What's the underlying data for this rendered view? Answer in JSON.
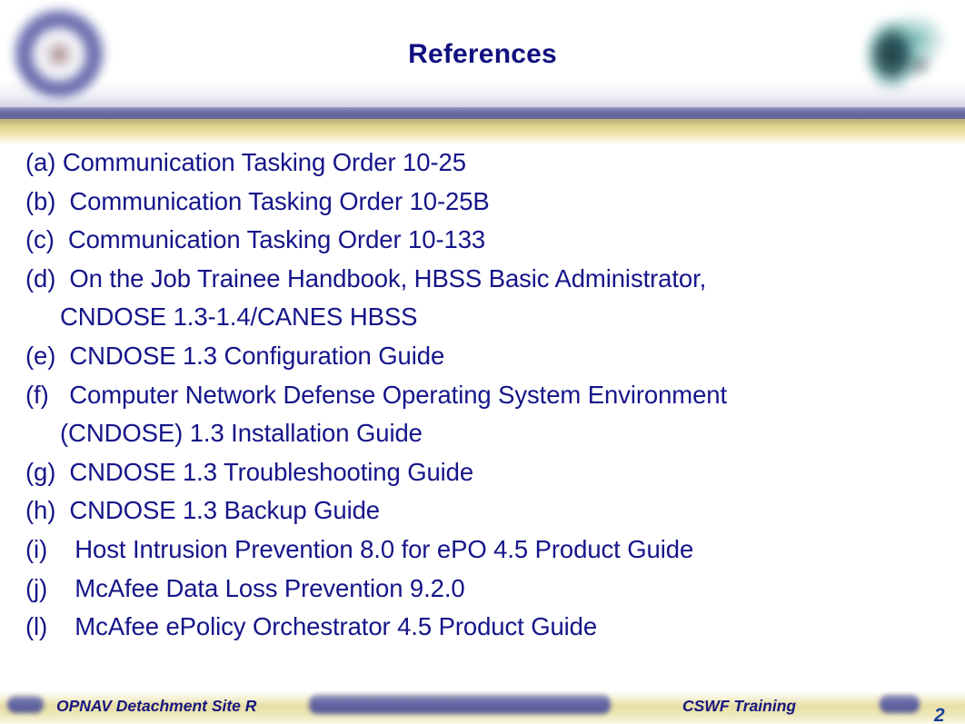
{
  "slide": {
    "title": "References",
    "title_color": "#101080",
    "body_text_color": "#15158a",
    "accent_purple": "#63669e",
    "accent_gold": "#e7dda0",
    "background": "#ffffff"
  },
  "header": {
    "title": "References",
    "logo_left_name": "navy-seal-emblem",
    "logo_right_name": "teal-command-emblem"
  },
  "references": {
    "lines": [
      {
        "text": "(a) Communication Tasking Order 10-25",
        "continuation": false
      },
      {
        "text": "(b)  Communication Tasking Order 10-25B",
        "continuation": false
      },
      {
        "text": "(c)  Communication Tasking Order 10-133",
        "continuation": false
      },
      {
        "text": "(d)  On the Job Trainee Handbook, HBSS Basic Administrator,",
        "continuation": false
      },
      {
        "text": "CNDOSE 1.3-1.4/CANES HBSS",
        "continuation": true
      },
      {
        "text": "(e)  CNDOSE 1.3 Configuration Guide",
        "continuation": false
      },
      {
        "text": "(f)   Computer Network Defense Operating System Environment",
        "continuation": false
      },
      {
        "text": "(CNDOSE) 1.3 Installation Guide",
        "continuation": true
      },
      {
        "text": "(g)  CNDOSE 1.3 Troubleshooting Guide",
        "continuation": false
      },
      {
        "text": "(h)  CNDOSE 1.3 Backup Guide",
        "continuation": false
      },
      {
        "text": "(i)    Host Intrusion Prevention 8.0 for ePO 4.5 Product Guide",
        "continuation": false
      },
      {
        "text": "(j)    McAfee Data Loss Prevention 9.2.0",
        "continuation": false
      },
      {
        "text": "(l)    McAfee ePolicy Orchestrator 4.5 Product Guide",
        "continuation": false
      }
    ]
  },
  "footer": {
    "left_text": "OPNAV Detachment Site R",
    "right_text": "CSWF Training",
    "page_number": "2"
  }
}
